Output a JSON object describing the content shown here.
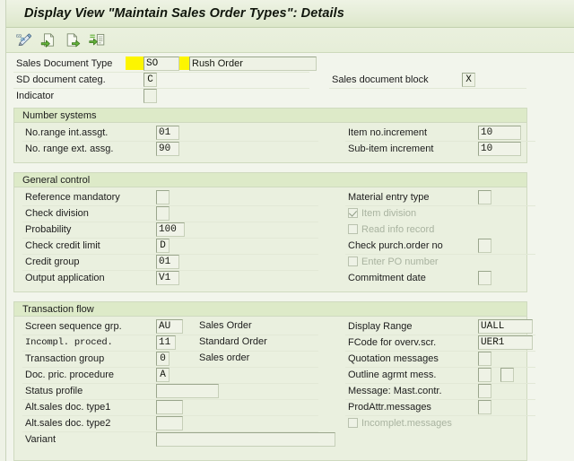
{
  "window": {
    "title": "Display View \"Maintain Sales Order Types\": Details"
  },
  "toolbar": {
    "buttons": [
      {
        "name": "display-change-icon",
        "tooltip": "Display <-> Change"
      },
      {
        "name": "new-entries-icon",
        "tooltip": "New Entries"
      },
      {
        "name": "copy-as-icon",
        "tooltip": "Copy As..."
      },
      {
        "name": "details-icon",
        "tooltip": "Details"
      }
    ]
  },
  "header_fields": {
    "sales_document_type": {
      "label": "Sales Document Type",
      "value": "SO",
      "description": "Rush Order",
      "highlighted": true
    },
    "sd_document_categ": {
      "label": "SD document categ.",
      "value": "C"
    },
    "indicator": {
      "label": "Indicator",
      "value": ""
    },
    "sales_document_block": {
      "label": "Sales document block",
      "value": "X"
    }
  },
  "groups": {
    "number_systems": {
      "title": "Number systems",
      "left": [
        {
          "label": "No.range int.assgt.",
          "value": "01"
        },
        {
          "label": "No. range ext. assg.",
          "value": "90"
        }
      ],
      "right": [
        {
          "label": "Item no.increment",
          "value": "10"
        },
        {
          "label": "Sub-item increment",
          "value": "10"
        }
      ]
    },
    "general_control": {
      "title": "General control",
      "left": [
        {
          "label": "Reference mandatory",
          "value": "",
          "type": "flag"
        },
        {
          "label": "Check division",
          "value": "",
          "type": "flag"
        },
        {
          "label": "Probability",
          "value": "100",
          "type": "input"
        },
        {
          "label": "Check credit limit",
          "value": "D",
          "type": "flag"
        },
        {
          "label": "Credit group",
          "value": "01",
          "type": "input"
        },
        {
          "label": "Output application",
          "value": "V1",
          "type": "input"
        }
      ],
      "right": [
        {
          "label": "Material entry type",
          "value": "",
          "type": "flag"
        },
        {
          "label": "Item division",
          "type": "checkbox",
          "checked": true,
          "disabled": true
        },
        {
          "label": "Read info record",
          "type": "checkbox",
          "checked": false,
          "disabled": true
        },
        {
          "label": "Check purch.order no",
          "value": "",
          "type": "flag"
        },
        {
          "label": "Enter PO number",
          "type": "checkbox",
          "checked": false,
          "disabled": true
        },
        {
          "label": "Commitment  date",
          "value": "",
          "type": "flag"
        }
      ]
    },
    "transaction_flow": {
      "title": "Transaction flow",
      "left": [
        {
          "label": "Screen sequence grp.",
          "value": "AU",
          "desc": "Sales Order",
          "type": "input"
        },
        {
          "label": "Incompl. proced.",
          "value": "11",
          "desc": "Standard Order",
          "type": "input",
          "mono_label": true
        },
        {
          "label": "Transaction group",
          "value": "0",
          "desc": "Sales order",
          "type": "flag"
        },
        {
          "label": "Doc. pric. procedure",
          "value": "A",
          "desc": "",
          "type": "flag"
        },
        {
          "label": "Status profile",
          "value": "",
          "desc": "",
          "type": "wide"
        },
        {
          "label": "Alt.sales doc. type1",
          "value": "",
          "desc": "",
          "type": "input"
        },
        {
          "label": "Alt.sales doc. type2",
          "value": "",
          "desc": "",
          "type": "input"
        },
        {
          "label": "Variant",
          "value": "",
          "desc": "",
          "type": "widest"
        }
      ],
      "right": [
        {
          "label": "Display Range",
          "value": "UALL",
          "type": "input"
        },
        {
          "label": "FCode for overv.scr.",
          "value": "UER1",
          "type": "input"
        },
        {
          "label": "Quotation messages",
          "value": "",
          "type": "flag"
        },
        {
          "label": "Outline agrmt mess.",
          "value": "",
          "type": "flag2"
        },
        {
          "label": "Message: Mast.contr.",
          "value": "",
          "type": "flag"
        },
        {
          "label": "ProdAttr.messages",
          "value": "",
          "type": "flag"
        },
        {
          "label": "Incomplet.messages",
          "type": "checkbox",
          "checked": false,
          "disabled": true
        }
      ]
    }
  },
  "colors": {
    "page_background": "#f2f5ec",
    "group_background": "#eaf0df",
    "group_header": "#ddeac8",
    "title_bar": "#e4ecd6",
    "highlight_marker": "#fdf500",
    "field_border": "#9aa68c"
  }
}
